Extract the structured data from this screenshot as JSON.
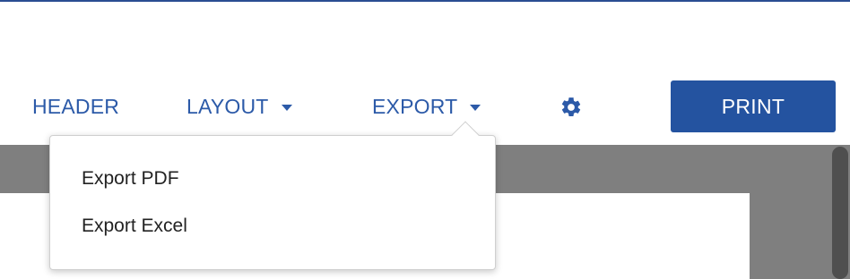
{
  "toolbar": {
    "header_label": "HEADER",
    "layout_label": "LAYOUT",
    "export_label": "EXPORT",
    "settings_icon": "gear-icon",
    "print_label": "PRINT"
  },
  "export_menu": {
    "items": [
      {
        "label": "Export PDF"
      },
      {
        "label": "Export Excel"
      }
    ]
  },
  "colors": {
    "accent": "#2c5aa8",
    "print_button": "#2453a0",
    "content_background": "#7f7f7f"
  }
}
